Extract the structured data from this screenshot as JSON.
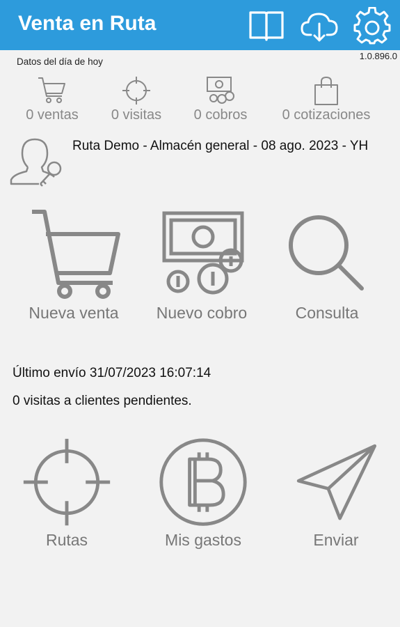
{
  "app": {
    "title": "Venta en Ruta",
    "version": "1.0.896.0"
  },
  "toolbar": {
    "icons": [
      "book-icon",
      "cloud-download-icon",
      "gear-icon"
    ]
  },
  "summary": {
    "title": "Datos del día de hoy",
    "stats": [
      {
        "icon": "cart-icon",
        "label": "0 ventas"
      },
      {
        "icon": "crosshair-icon",
        "label": "0 visitas"
      },
      {
        "icon": "cash-icon",
        "label": "0 cobros"
      },
      {
        "icon": "shopping-bag-icon",
        "label": "0 cotizaciones"
      }
    ]
  },
  "route": {
    "text": "Ruta Demo - Almacén general - 08 ago. 2023 - YH"
  },
  "actions_top": [
    {
      "icon": "cart-icon",
      "label": "Nueva venta"
    },
    {
      "icon": "cash-coins-icon",
      "label": "Nuevo cobro"
    },
    {
      "icon": "magnifier-icon",
      "label": "Consulta"
    }
  ],
  "status": {
    "last_sync": "Último envío 31/07/2023 16:07:14",
    "pending_visits": "0 visitas a clientes pendientes."
  },
  "actions_bottom": [
    {
      "icon": "crosshair-icon",
      "label": "Rutas"
    },
    {
      "icon": "bitcoin-icon",
      "label": "Mis gastos"
    },
    {
      "icon": "send-icon",
      "label": "Enviar"
    }
  ],
  "colors": {
    "appbar": "#2d9bdc",
    "icon_gray": "#888888",
    "background": "#f2f2f2"
  }
}
